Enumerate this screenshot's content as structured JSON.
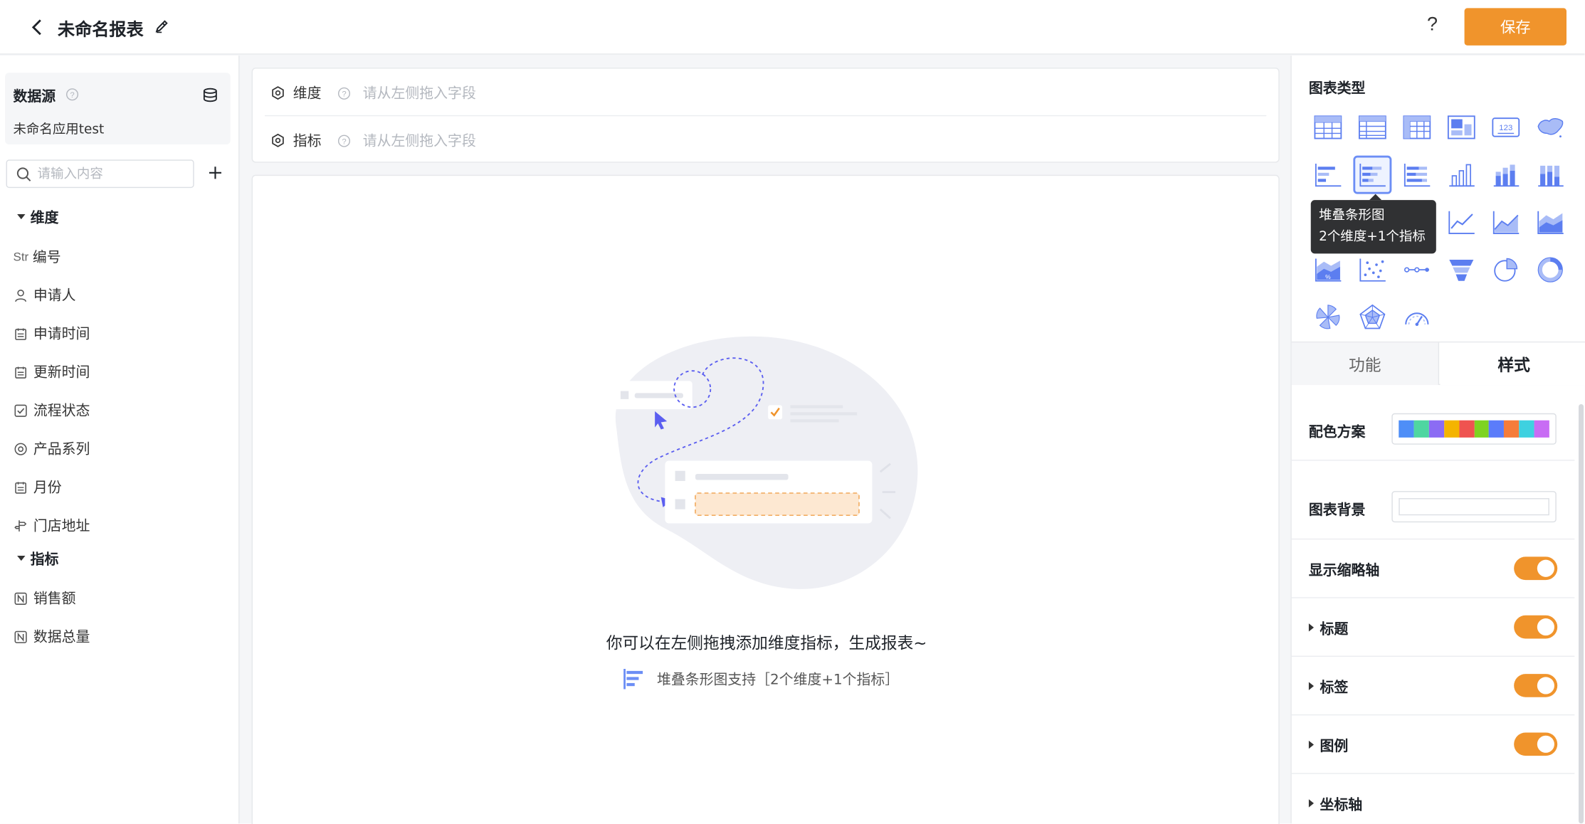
{
  "header": {
    "title": "未命名报表",
    "help_label": "?",
    "save_label": "保存"
  },
  "left": {
    "datasource_label": "数据源",
    "datasource_name": "未命名应用test",
    "search_placeholder": "请输入内容",
    "dimension_group": "维度",
    "metric_group": "指标",
    "dimensions": [
      {
        "type": "Str",
        "label": "编号"
      },
      {
        "type": "user",
        "label": "申请人"
      },
      {
        "type": "date",
        "label": "申请时间"
      },
      {
        "type": "date",
        "label": "更新时间"
      },
      {
        "type": "check",
        "label": "流程状态"
      },
      {
        "type": "radio",
        "label": "产品系列"
      },
      {
        "type": "date",
        "label": "月份"
      },
      {
        "type": "location",
        "label": "门店地址"
      }
    ],
    "metrics": [
      {
        "type": "number",
        "label": "销售额"
      },
      {
        "type": "number",
        "label": "数据总量"
      }
    ]
  },
  "center": {
    "dimension_label": "维度",
    "metric_label": "指标",
    "drop_placeholder": "请从左侧拖入字段",
    "empty_text": "你可以在左侧拖拽添加维度指标，生成报表~",
    "empty_hint": "堆叠条形图支持［2个维度+1个指标］"
  },
  "right": {
    "chart_type_title": "图表类型",
    "tooltip_title": "堆叠条形图",
    "tooltip_desc": "2个维度+1个指标",
    "tab_function": "功能",
    "tab_style": "样式",
    "color_scheme_label": "配色方案",
    "chart_bg_label": "图表背景",
    "show_axis_label": "显示缩略轴",
    "title_label": "标题",
    "tag_label": "标签",
    "legend_label": "图例",
    "axis_label": "坐标轴",
    "palette": [
      "#4e8ef7",
      "#4fd6a1",
      "#8b6cf4",
      "#f4b400",
      "#ef5350",
      "#7ed321",
      "#5b7cfa",
      "#f57c3a",
      "#3ed1e0",
      "#c86cf4"
    ]
  }
}
